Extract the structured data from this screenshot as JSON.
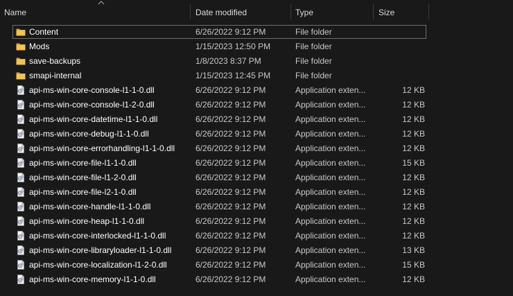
{
  "columns": {
    "name": "Name",
    "date_modified": "Date modified",
    "type": "Type",
    "size": "Size"
  },
  "sort": {
    "column": "name",
    "direction": "ascending",
    "icon": "sort-ascending-arrow-icon"
  },
  "rows": [
    {
      "name": "Content",
      "date": "6/26/2022 9:12 PM",
      "type": "File folder",
      "size": "",
      "icon": "folder-icon",
      "selected": true
    },
    {
      "name": "Mods",
      "date": "1/15/2023 12:50 PM",
      "type": "File folder",
      "size": "",
      "icon": "folder-icon"
    },
    {
      "name": "save-backups",
      "date": "1/8/2023 8:37 PM",
      "type": "File folder",
      "size": "",
      "icon": "folder-icon"
    },
    {
      "name": "smapi-internal",
      "date": "1/15/2023 12:45 PM",
      "type": "File folder",
      "size": "",
      "icon": "folder-icon"
    },
    {
      "name": "api-ms-win-core-console-l1-1-0.dll",
      "date": "6/26/2022 9:12 PM",
      "type": "Application exten...",
      "size": "12 KB",
      "icon": "dll-file-icon"
    },
    {
      "name": "api-ms-win-core-console-l1-2-0.dll",
      "date": "6/26/2022 9:12 PM",
      "type": "Application exten...",
      "size": "12 KB",
      "icon": "dll-file-icon"
    },
    {
      "name": "api-ms-win-core-datetime-l1-1-0.dll",
      "date": "6/26/2022 9:12 PM",
      "type": "Application exten...",
      "size": "12 KB",
      "icon": "dll-file-icon"
    },
    {
      "name": "api-ms-win-core-debug-l1-1-0.dll",
      "date": "6/26/2022 9:12 PM",
      "type": "Application exten...",
      "size": "12 KB",
      "icon": "dll-file-icon"
    },
    {
      "name": "api-ms-win-core-errorhandling-l1-1-0.dll",
      "date": "6/26/2022 9:12 PM",
      "type": "Application exten...",
      "size": "12 KB",
      "icon": "dll-file-icon"
    },
    {
      "name": "api-ms-win-core-file-l1-1-0.dll",
      "date": "6/26/2022 9:12 PM",
      "type": "Application exten...",
      "size": "15 KB",
      "icon": "dll-file-icon"
    },
    {
      "name": "api-ms-win-core-file-l1-2-0.dll",
      "date": "6/26/2022 9:12 PM",
      "type": "Application exten...",
      "size": "12 KB",
      "icon": "dll-file-icon"
    },
    {
      "name": "api-ms-win-core-file-l2-1-0.dll",
      "date": "6/26/2022 9:12 PM",
      "type": "Application exten...",
      "size": "12 KB",
      "icon": "dll-file-icon"
    },
    {
      "name": "api-ms-win-core-handle-l1-1-0.dll",
      "date": "6/26/2022 9:12 PM",
      "type": "Application exten...",
      "size": "12 KB",
      "icon": "dll-file-icon"
    },
    {
      "name": "api-ms-win-core-heap-l1-1-0.dll",
      "date": "6/26/2022 9:12 PM",
      "type": "Application exten...",
      "size": "12 KB",
      "icon": "dll-file-icon"
    },
    {
      "name": "api-ms-win-core-interlocked-l1-1-0.dll",
      "date": "6/26/2022 9:12 PM",
      "type": "Application exten...",
      "size": "12 KB",
      "icon": "dll-file-icon"
    },
    {
      "name": "api-ms-win-core-libraryloader-l1-1-0.dll",
      "date": "6/26/2022 9:12 PM",
      "type": "Application exten...",
      "size": "13 KB",
      "icon": "dll-file-icon"
    },
    {
      "name": "api-ms-win-core-localization-l1-2-0.dll",
      "date": "6/26/2022 9:12 PM",
      "type": "Application exten...",
      "size": "15 KB",
      "icon": "dll-file-icon"
    },
    {
      "name": "api-ms-win-core-memory-l1-1-0.dll",
      "date": "6/26/2022 9:12 PM",
      "type": "Application exten...",
      "size": "12 KB",
      "icon": "dll-file-icon"
    }
  ],
  "colors": {
    "background": "#191919",
    "folder": "#e8b84a",
    "selection_border": "#6e6e6e"
  }
}
